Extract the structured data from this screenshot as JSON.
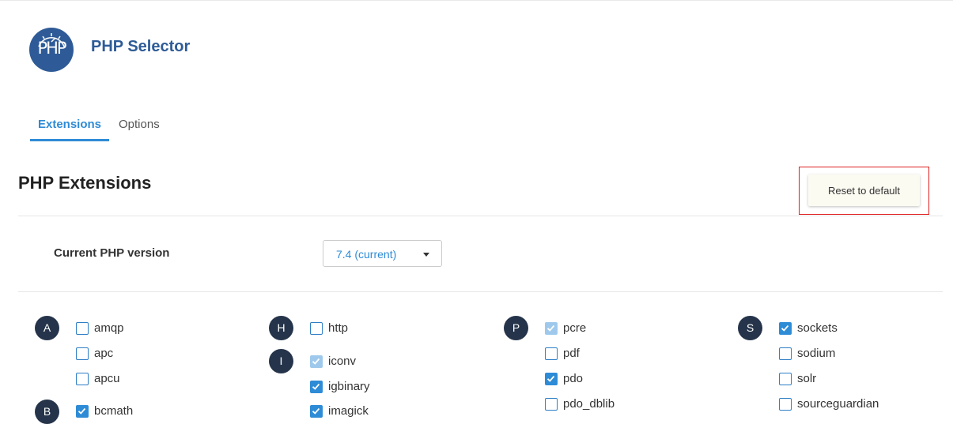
{
  "app": {
    "logo_text": "PHP",
    "title": "PHP Selector"
  },
  "tabs": [
    {
      "label": "Extensions",
      "active": true
    },
    {
      "label": "Options",
      "active": false
    }
  ],
  "section": {
    "title": "PHP Extensions",
    "reset_label": "Reset to default"
  },
  "version": {
    "label": "Current PHP version",
    "value": "7.4 (current)"
  },
  "colors": {
    "accent": "#2e8bd6",
    "brand": "#2e5b97",
    "letter_badge": "#25344a",
    "highlight": "#e02020"
  },
  "extensions": {
    "letters": [
      "A",
      "B",
      "H",
      "I",
      "P",
      "S"
    ],
    "items": [
      {
        "name": "amqp",
        "checked": false,
        "disabled": false
      },
      {
        "name": "apc",
        "checked": false,
        "disabled": false
      },
      {
        "name": "apcu",
        "checked": false,
        "disabled": false
      },
      {
        "name": "bcmath",
        "checked": true,
        "disabled": false
      },
      {
        "name": "http",
        "checked": false,
        "disabled": false
      },
      {
        "name": "iconv",
        "checked": true,
        "disabled": true
      },
      {
        "name": "igbinary",
        "checked": true,
        "disabled": false
      },
      {
        "name": "imagick",
        "checked": true,
        "disabled": false
      },
      {
        "name": "pcre",
        "checked": true,
        "disabled": true
      },
      {
        "name": "pdf",
        "checked": false,
        "disabled": false
      },
      {
        "name": "pdo",
        "checked": true,
        "disabled": false
      },
      {
        "name": "pdo_dblib",
        "checked": false,
        "disabled": false
      },
      {
        "name": "sockets",
        "checked": true,
        "disabled": false
      },
      {
        "name": "sodium",
        "checked": false,
        "disabled": false
      },
      {
        "name": "solr",
        "checked": false,
        "disabled": false
      },
      {
        "name": "sourceguardian",
        "checked": false,
        "disabled": false
      }
    ]
  }
}
